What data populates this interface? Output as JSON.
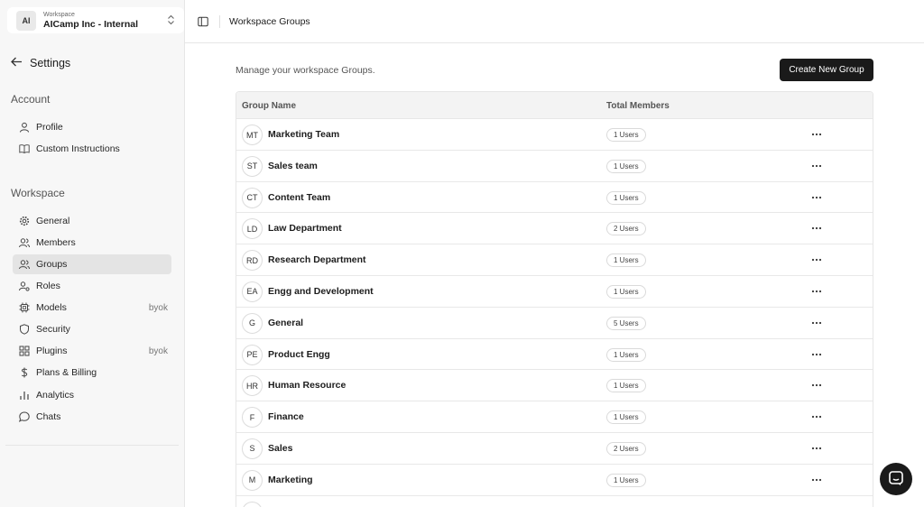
{
  "workspace": {
    "avatar": "AI",
    "caption": "Workspace",
    "name": "AICamp Inc - Internal"
  },
  "settings_label": "Settings",
  "account_section": {
    "title": "Account",
    "items": [
      {
        "label": "Profile",
        "icon": "user-icon"
      },
      {
        "label": "Custom Instructions",
        "icon": "book-icon"
      }
    ]
  },
  "workspace_section": {
    "title": "Workspace",
    "items": [
      {
        "label": "General",
        "icon": "gear-icon",
        "badge": ""
      },
      {
        "label": "Members",
        "icon": "users-icon",
        "badge": ""
      },
      {
        "label": "Groups",
        "icon": "group-icon",
        "badge": "",
        "active": true
      },
      {
        "label": "Roles",
        "icon": "role-icon",
        "badge": ""
      },
      {
        "label": "Models",
        "icon": "chip-icon",
        "badge": "byok"
      },
      {
        "label": "Security",
        "icon": "shield-icon",
        "badge": ""
      },
      {
        "label": "Plugins",
        "icon": "puzzle-icon",
        "badge": "byok"
      },
      {
        "label": "Plans & Billing",
        "icon": "dollar-icon",
        "badge": ""
      },
      {
        "label": "Analytics",
        "icon": "chart-icon",
        "badge": ""
      },
      {
        "label": "Chats",
        "icon": "chat-icon",
        "badge": ""
      }
    ]
  },
  "topbar": {
    "title": "Workspace Groups"
  },
  "main": {
    "description": "Manage your workspace Groups.",
    "create_button": "Create New Group",
    "columns": {
      "name": "Group Name",
      "members": "Total Members"
    },
    "groups": [
      {
        "initials": "MT",
        "name": "Marketing Team",
        "members": "1 Users"
      },
      {
        "initials": "ST",
        "name": "Sales team",
        "members": "1 Users"
      },
      {
        "initials": "CT",
        "name": "Content Team",
        "members": "1 Users"
      },
      {
        "initials": "LD",
        "name": "Law Department",
        "members": "2 Users"
      },
      {
        "initials": "RD",
        "name": "Research Department",
        "members": "1 Users"
      },
      {
        "initials": "EA",
        "name": "Engg and Development",
        "members": "1 Users"
      },
      {
        "initials": "G",
        "name": "General",
        "members": "5 Users"
      },
      {
        "initials": "PE",
        "name": "Product Engg",
        "members": "1 Users"
      },
      {
        "initials": "HR",
        "name": "Human Resource",
        "members": "1 Users"
      },
      {
        "initials": "F",
        "name": "Finance",
        "members": "1 Users"
      },
      {
        "initials": "S",
        "name": "Sales",
        "members": "2 Users"
      },
      {
        "initials": "M",
        "name": "Marketing",
        "members": "1 Users"
      },
      {
        "initials": "",
        "name": "",
        "members": ""
      }
    ]
  }
}
